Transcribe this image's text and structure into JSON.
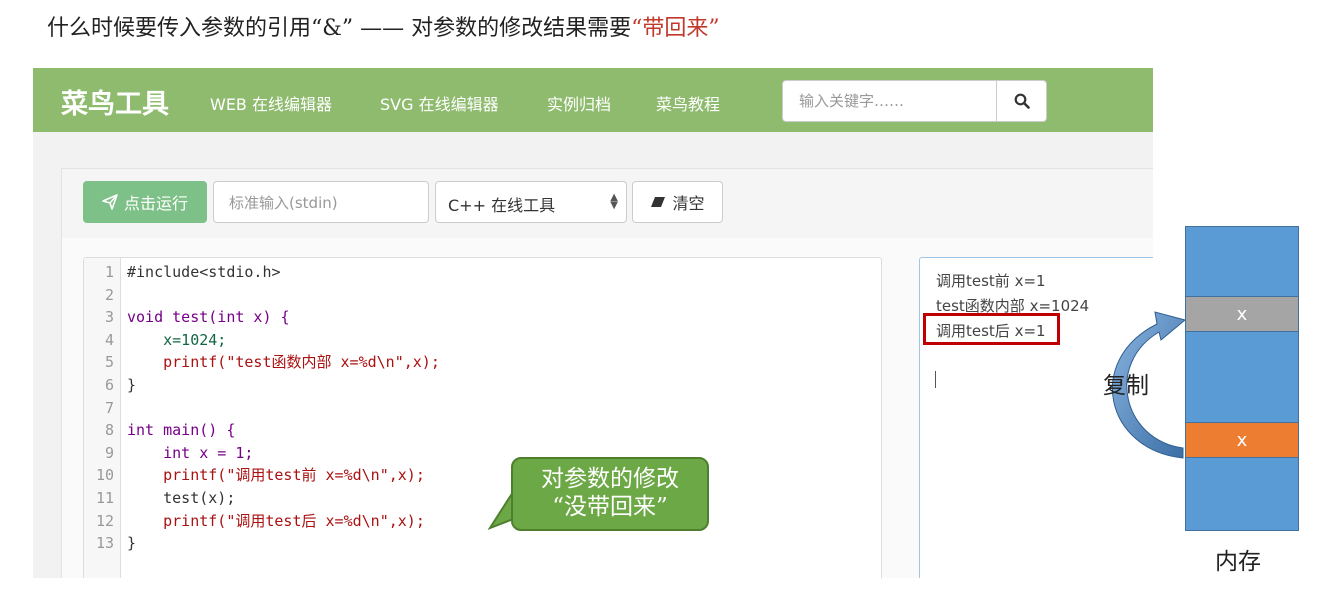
{
  "heading": {
    "prefix": "什么时候要传入参数的引用“&” —— 对参数的修改结果需要",
    "highlight": "“带回来”"
  },
  "navbar": {
    "brand": "菜鸟工具",
    "links": [
      "WEB 在线编辑器",
      "SVG 在线编辑器",
      "实例归档",
      "菜鸟教程"
    ],
    "search_placeholder": "输入关键字……",
    "search_icon": "search-icon"
  },
  "toolbar": {
    "run_label": "点击运行",
    "stdin_placeholder": "标准输入(stdin)",
    "language": "C++ 在线工具",
    "clear_label": "清空"
  },
  "code_lines": [
    {
      "n": "1",
      "text": "#include<stdio.h>"
    },
    {
      "n": "2",
      "text": ""
    },
    {
      "n": "3",
      "text": "void test(int x) {"
    },
    {
      "n": "4",
      "text": "    x=1024;"
    },
    {
      "n": "5",
      "text": "    printf(\"test函数内部 x=%d\\n\",x);"
    },
    {
      "n": "6",
      "text": "}"
    },
    {
      "n": "7",
      "text": ""
    },
    {
      "n": "8",
      "text": "int main() {"
    },
    {
      "n": "9",
      "text": "    int x = 1;"
    },
    {
      "n": "10",
      "text": "    printf(\"调用test前 x=%d\\n\",x);"
    },
    {
      "n": "11",
      "text": "    test(x);"
    },
    {
      "n": "12",
      "text": "    printf(\"调用test后 x=%d\\n\",x);"
    },
    {
      "n": "13",
      "text": "}"
    }
  ],
  "output_lines": [
    "调用test前 x=1",
    "test函数内部 x=1024",
    "调用test后 x=1"
  ],
  "callout": {
    "line1": "对参数的修改",
    "line2": "“没带回来”"
  },
  "memory": {
    "cell_top": "x",
    "cell_bottom": "x",
    "label": "内存",
    "copy_label": "复制"
  },
  "colors": {
    "nav": "#8fbb6f",
    "run": "#7ec188",
    "memory": "#5b9bd5",
    "cell_top": "#a5a5a5",
    "cell_bottom": "#ed7d31",
    "highlight": "#c00000"
  }
}
